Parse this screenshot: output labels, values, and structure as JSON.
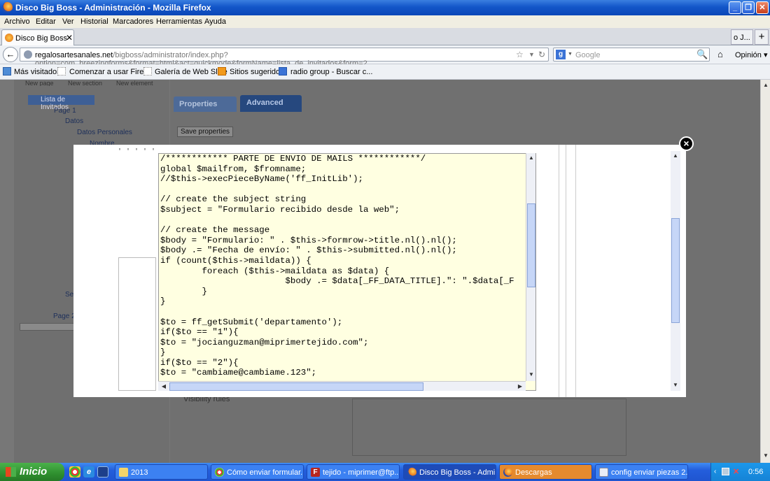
{
  "window": {
    "title": "Disco Big Boss - Administración - Mozilla Firefox",
    "controls": [
      "_",
      "❐",
      "✕"
    ]
  },
  "menu": [
    "Archivo",
    "Editar",
    "Ver",
    "Historial",
    "Marcadores",
    "Herramientas",
    "Ayuda"
  ],
  "tabs": {
    "active": "Disco Big Boss ...",
    "other": "o J...",
    "new_tab": "+"
  },
  "nav": {
    "url_host": "regalosartesanales.net",
    "url_path": "/bigboss/administrator/index.php?option=com_breezingforms&format=html&act=quickmode&formName=lista_de_invitados&form=2",
    "search_placeholder": "Google",
    "opinion": "Opinión"
  },
  "bookmarks": [
    "Más visitados",
    "Comenzar a usar Firef...",
    "Galería de Web Slice",
    "Sitios sugeridos",
    "radio group - Buscar c..."
  ],
  "page": {
    "top_buttons": [
      "New page",
      "New section",
      "New element"
    ],
    "tree": {
      "root": "Lista de Invitados",
      "page1": "Page 1",
      "datos": "Datos",
      "datos_personales": "Datos Personales",
      "nombre": "Nombre",
      "section_partial": "Se",
      "page2": "Page 2"
    },
    "tab_properties": "Properties",
    "tab_advanced": "Advanced",
    "save_properties": "Save properties",
    "visibility_rules": "Visibility rules"
  },
  "modal": {
    "close": "×",
    "code_lines": [
      "/************ PARTE DE ENVIO DE MAILS ************/",
      "global $mailfrom, $fromname;",
      "//$this->execPieceByName('ff_InitLib');",
      "",
      "// create the subject string",
      "$subject = \"Formulario recibido desde la web\";",
      "",
      "// create the message",
      "$body = \"Formulario: \" . $this->formrow->title.nl().nl();",
      "$body .= \"Fecha de envío: \" . $this->submitted.nl().nl();",
      "if (count($this->maildata)) {",
      "        foreach ($this->maildata as $data) {",
      "                        $body .= $data[_FF_DATA_TITLE].\": \".$data[_F",
      "        }",
      "}",
      "",
      "$to = ff_getSubmit('departamento');",
      "if($to == \"1\"){",
      "$to = \"jocianguzman@miprimertejido.com\";",
      "}",
      "if($to == \"2\"){",
      "$to = \"cambiame@cambiame.123\";"
    ]
  },
  "taskbar": {
    "start": "Inicio",
    "items": [
      {
        "label": "2013",
        "icon": "folder-icon"
      },
      {
        "label": "Cómo enviar formular...",
        "icon": "chrome-icon"
      },
      {
        "label": "tejido - miprimer@ftp....",
        "icon": "filezilla-icon"
      },
      {
        "label": "Disco Big Boss - Admi...",
        "icon": "firefox-icon"
      },
      {
        "label": "Descargas",
        "icon": "downloads-icon"
      },
      {
        "label": "config enviar piezas 2...",
        "icon": "document-icon"
      }
    ],
    "clock": "0:56"
  },
  "colors": {
    "titlebar": "#1356c9",
    "taskbar": "#245edc",
    "start": "#2f8f2f",
    "code_bg": "#ffffe1",
    "overlay": "#777777"
  }
}
